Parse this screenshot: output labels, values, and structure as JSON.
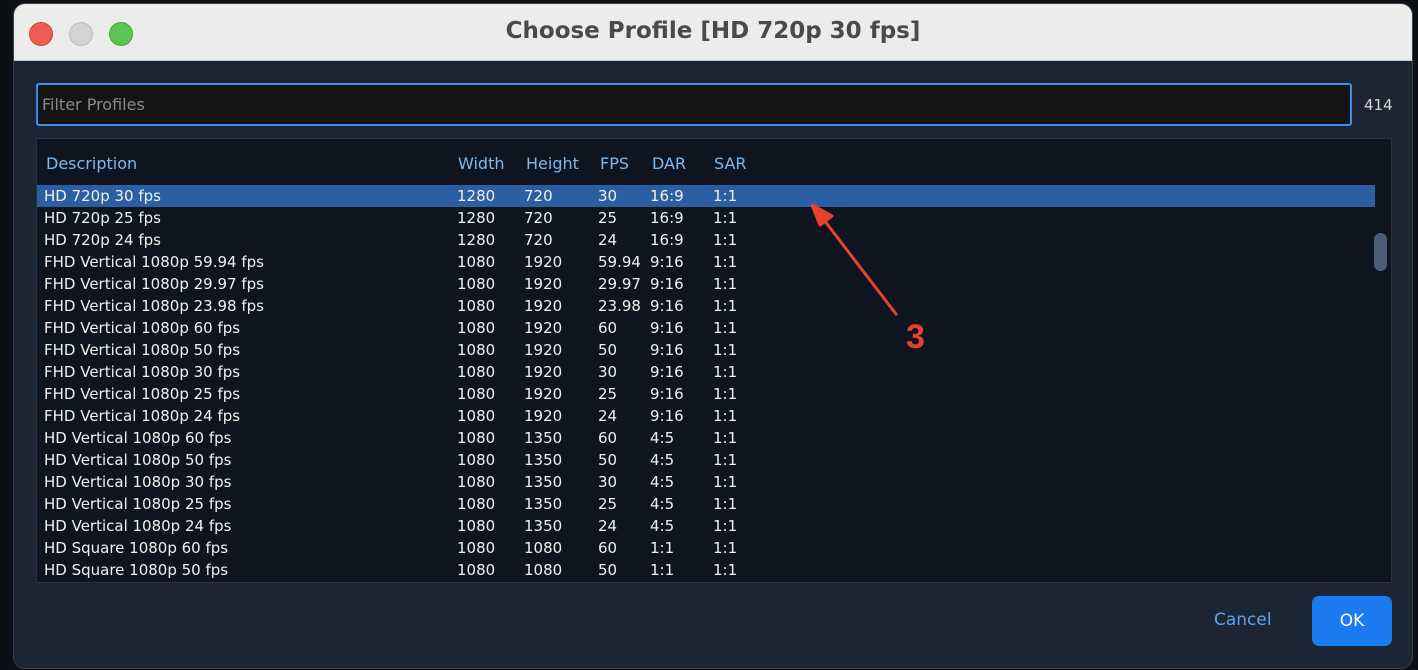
{
  "window": {
    "title": "Choose Profile [HD 720p 30 fps]"
  },
  "filter": {
    "placeholder": "Filter Profiles",
    "value": "",
    "count": "414"
  },
  "table": {
    "headers": [
      "Description",
      "Width",
      "Height",
      "FPS",
      "DAR",
      "SAR"
    ],
    "selected_index": 0,
    "rows": [
      [
        "HD 720p 30 fps",
        "1280",
        "720",
        "30",
        "16:9",
        "1:1"
      ],
      [
        "HD 720p 25 fps",
        "1280",
        "720",
        "25",
        "16:9",
        "1:1"
      ],
      [
        "HD 720p 24 fps",
        "1280",
        "720",
        "24",
        "16:9",
        "1:1"
      ],
      [
        "FHD Vertical 1080p 59.94 fps",
        "1080",
        "1920",
        "59.94",
        "9:16",
        "1:1"
      ],
      [
        "FHD Vertical 1080p 29.97 fps",
        "1080",
        "1920",
        "29.97",
        "9:16",
        "1:1"
      ],
      [
        "FHD Vertical 1080p 23.98 fps",
        "1080",
        "1920",
        "23.98",
        "9:16",
        "1:1"
      ],
      [
        "FHD Vertical 1080p 60 fps",
        "1080",
        "1920",
        "60",
        "9:16",
        "1:1"
      ],
      [
        "FHD Vertical 1080p 50 fps",
        "1080",
        "1920",
        "50",
        "9:16",
        "1:1"
      ],
      [
        "FHD Vertical 1080p 30 fps",
        "1080",
        "1920",
        "30",
        "9:16",
        "1:1"
      ],
      [
        "FHD Vertical 1080p 25 fps",
        "1080",
        "1920",
        "25",
        "9:16",
        "1:1"
      ],
      [
        "FHD Vertical 1080p 24 fps",
        "1080",
        "1920",
        "24",
        "9:16",
        "1:1"
      ],
      [
        "HD Vertical 1080p 60 fps",
        "1080",
        "1350",
        "60",
        "4:5",
        "1:1"
      ],
      [
        "HD Vertical 1080p 50 fps",
        "1080",
        "1350",
        "50",
        "4:5",
        "1:1"
      ],
      [
        "HD Vertical 1080p 30 fps",
        "1080",
        "1350",
        "30",
        "4:5",
        "1:1"
      ],
      [
        "HD Vertical 1080p 25 fps",
        "1080",
        "1350",
        "25",
        "4:5",
        "1:1"
      ],
      [
        "HD Vertical 1080p 24 fps",
        "1080",
        "1350",
        "24",
        "4:5",
        "1:1"
      ],
      [
        "HD Square 1080p 60 fps",
        "1080",
        "1080",
        "60",
        "1:1",
        "1:1"
      ],
      [
        "HD Square 1080p 50 fps",
        "1080",
        "1080",
        "50",
        "1:1",
        "1:1"
      ]
    ]
  },
  "annotation": {
    "label": "3",
    "color": "#e8412c"
  },
  "buttons": {
    "cancel": "Cancel",
    "ok": "OK"
  },
  "colors": {
    "accent": "#1b7af0",
    "selection": "#2a5fa3",
    "header_text": "#7eb8ef"
  }
}
